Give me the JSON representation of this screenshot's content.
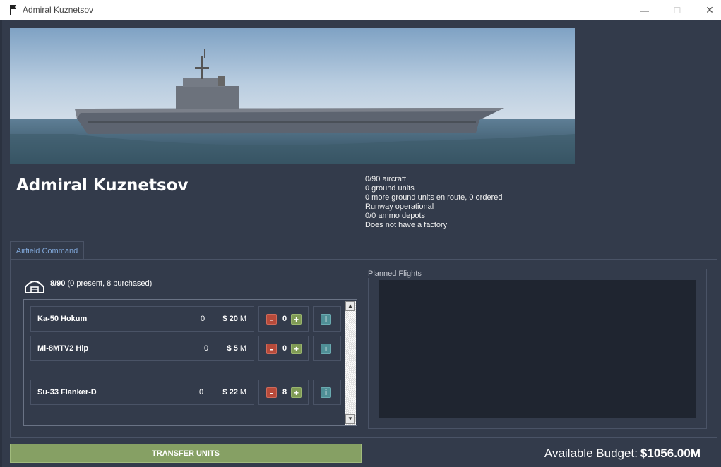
{
  "window": {
    "title": "Admiral Kuznetsov",
    "controls": {
      "minimize": "—",
      "maximize": "☐",
      "close": "✕"
    }
  },
  "unit": {
    "name": "Admiral Kuznetsov",
    "status": [
      "0/90 aircraft",
      "0 ground units",
      "0 more ground units en route, 0 ordered",
      "Runway operational",
      "0/0 ammo depots",
      "Does not have a factory"
    ]
  },
  "tabs": [
    {
      "label": "Airfield Command",
      "active": true
    }
  ],
  "aircraft_summary": {
    "count": "8/90",
    "detail": "(0 present, 8 purchased)"
  },
  "aircraft": [
    {
      "name": "Ka-50 Hokum",
      "available": "0",
      "price": "$ 20",
      "price_unit": "M",
      "ordered": "0"
    },
    {
      "name": "Mi-8MTV2 Hip",
      "available": "0",
      "price": "$ 5",
      "price_unit": "M",
      "ordered": "0"
    },
    {
      "name": "Su-33 Flanker-D",
      "available": "0",
      "price": "$ 22",
      "price_unit": "M",
      "ordered": "8"
    }
  ],
  "buttons": {
    "minus": "-",
    "plus": "+",
    "info": "i"
  },
  "scroll": {
    "up": "▲",
    "down": "▼"
  },
  "planned_flights": {
    "label": "Planned Flights"
  },
  "footer": {
    "transfer_label": "TRANSFER UNITS",
    "budget_label": "Available Budget:",
    "budget_value": "$1056.00M"
  },
  "colors": {
    "background": "#333b4b",
    "accent_tab": "#7fa6d8",
    "minus": "#b74a3a",
    "plus": "#7f9a55",
    "info": "#4f8f96",
    "transfer": "#86a064"
  },
  "icons": {
    "app": "flag-icon",
    "hangar": "hangar-icon"
  }
}
